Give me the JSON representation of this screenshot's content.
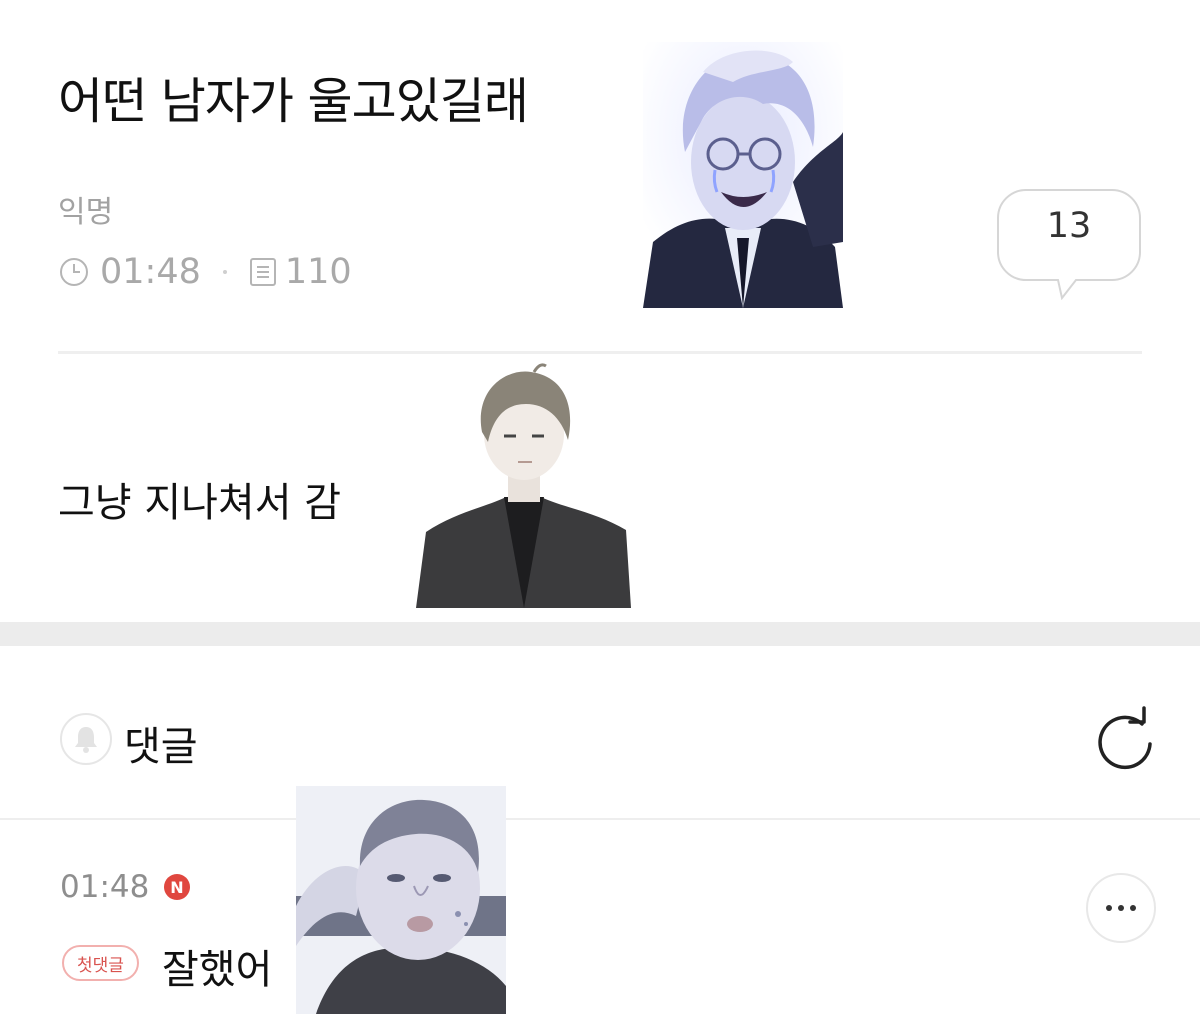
{
  "post": {
    "title": "어떤 남자가 울고있길래",
    "author": "익명",
    "time": "01:48",
    "views": "110",
    "comment_count": "13",
    "body": "그냥 지나쳐서 감"
  },
  "comments_section": {
    "title": "댓글",
    "icons": {
      "bell": "bell-icon",
      "refresh": "refresh-icon"
    }
  },
  "comment": {
    "time": "01:48",
    "new_badge": "N",
    "first_badge": "첫댓글",
    "text": "잘했어"
  },
  "colors": {
    "title_text": "#111111",
    "muted_text": "#a9a9a9",
    "new_badge": "#e0473f",
    "first_badge_border": "#f2b0ae"
  },
  "stickers": [
    "crying-man-sticker",
    "man-in-black-suit-sticker",
    "surprised-man-sticker"
  ]
}
